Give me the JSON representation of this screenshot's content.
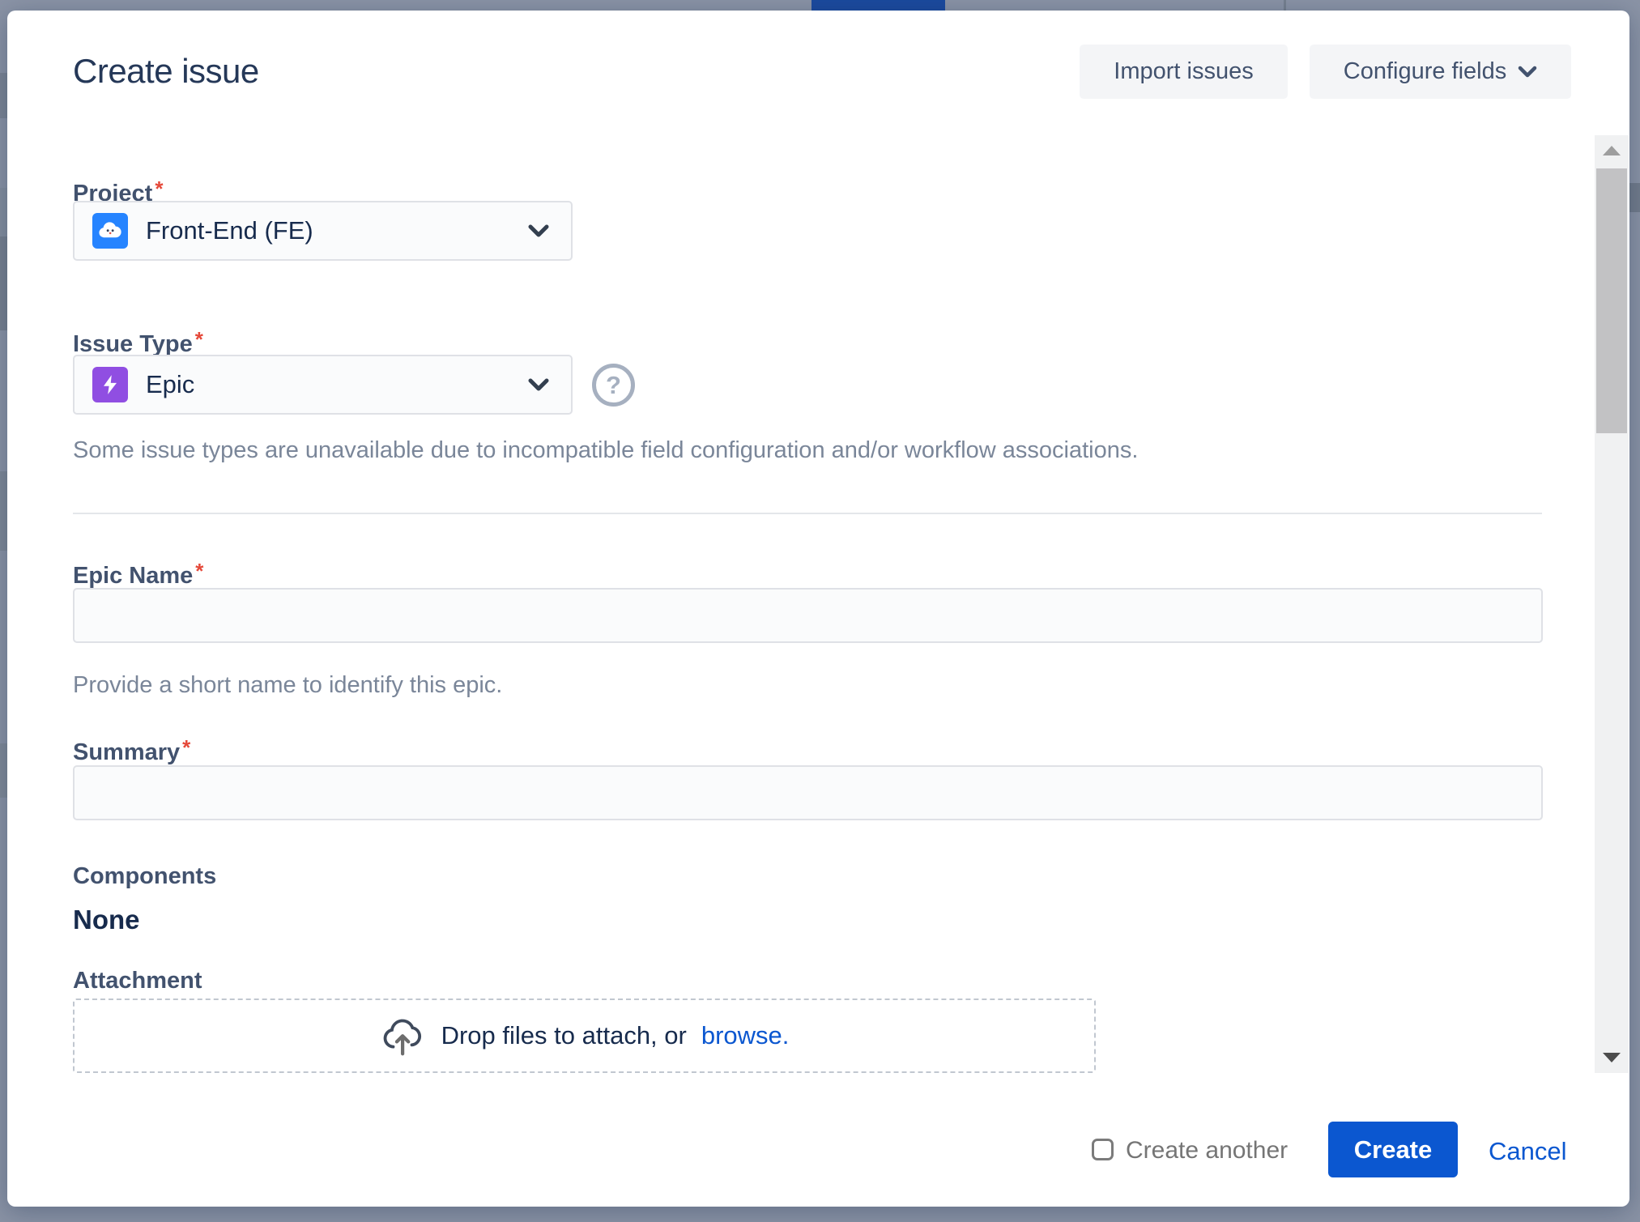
{
  "dialog": {
    "title": "Create issue",
    "required_marker": "*",
    "actions": {
      "import_label": "Import issues",
      "configure_label": "Configure fields"
    },
    "project": {
      "label": "Project",
      "value": "Front-End (FE)"
    },
    "issue_type": {
      "label": "Issue Type",
      "value": "Epic",
      "note": "Some issue types are unavailable due to incompatible field configuration and/or workflow associations."
    },
    "epic_name": {
      "label": "Epic Name",
      "value": "",
      "help": "Provide a short name to identify this epic."
    },
    "summary": {
      "label": "Summary",
      "value": ""
    },
    "components": {
      "label": "Components",
      "value": "None"
    },
    "attachment": {
      "label": "Attachment",
      "drop_text": "Drop files to attach, or",
      "browse_label": "browse."
    },
    "footer": {
      "create_another_label": "Create another",
      "create_another_checked": false,
      "create_label": "Create",
      "cancel_label": "Cancel"
    },
    "icons": {
      "project_avatar": "cloud-avatar",
      "issue_type_avatar": "epic-lightning",
      "help_glyph": "?",
      "select_chevron": "chevron-down",
      "configure_chevron": "chevron-down",
      "attachment_icon": "cloud-upload"
    },
    "colors": {
      "primary_button": "#0b57d0",
      "link": "#0b57d0",
      "epic_purple": "#904ee2",
      "project_blue": "#2684ff",
      "required_red": "#e5493a",
      "title_text": "#253858",
      "label_text": "#42526e",
      "helper_text": "#7a8699",
      "backdrop": "#8a93a5"
    }
  }
}
